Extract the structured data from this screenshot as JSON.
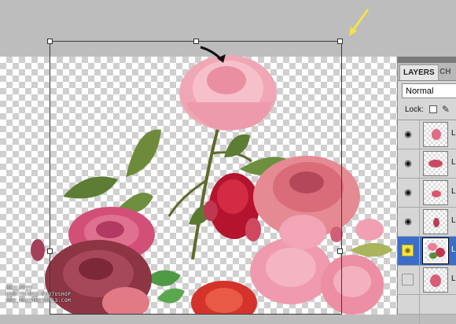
{
  "layers_panel": {
    "tabs": [
      {
        "label": "LAYERS",
        "active": true
      },
      {
        "label": "CH",
        "active": false
      }
    ],
    "blend_mode": "Normal",
    "lock_label": "Lock:",
    "layers": [
      {
        "name": "L",
        "visible": true,
        "selected": false
      },
      {
        "name": "L",
        "visible": true,
        "selected": false
      },
      {
        "name": "L",
        "visible": true,
        "selected": false
      },
      {
        "name": "L",
        "visible": true,
        "selected": false
      },
      {
        "name": "L",
        "visible": true,
        "selected": true
      },
      {
        "name": "L",
        "visible": false,
        "selected": false
      }
    ]
  },
  "watermark": {
    "line1": "MEILYYYY",
    "line2": "HOW TO USE PHOTOSHOP",
    "line3": "WWW.THAITHESIMS3.COM"
  },
  "colors": {
    "pasteboard": "#bdbdbd",
    "selected_layer": "#3a6ec8",
    "annotation_arrow": "#f2e24a"
  },
  "icons": [
    "eye-icon",
    "lock-transparent-icon",
    "lock-brush-icon",
    "annotation-arrow-black",
    "annotation-arrow-yellow"
  ]
}
